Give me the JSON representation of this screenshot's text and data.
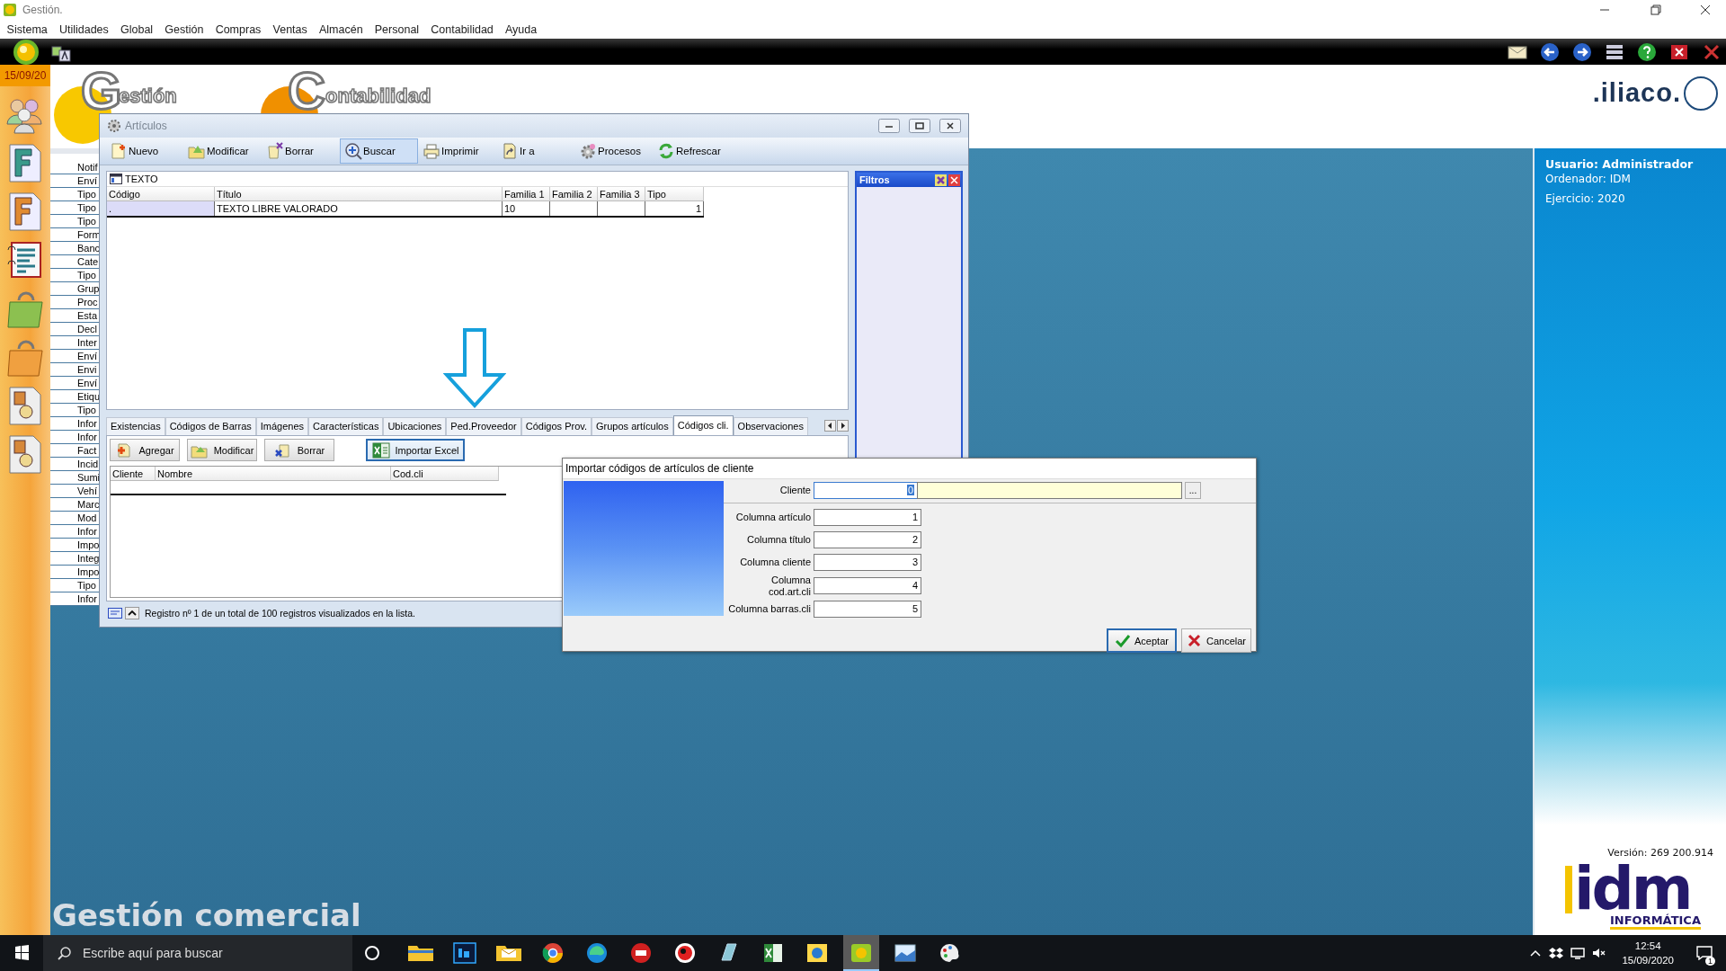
{
  "window": {
    "title": "Gestión."
  },
  "menu": [
    "Sistema",
    "Utilidades",
    "Global",
    "Gestión",
    "Compras",
    "Ventas",
    "Almacén",
    "Personal",
    "Contabilidad",
    "Ayuda"
  ],
  "date": "15/09/20",
  "banner": {
    "logos": [
      {
        "initial": "G",
        "rest": "estión"
      },
      {
        "initial": "C",
        "rest": "ontabilidad"
      }
    ],
    "brand": ".iliaco."
  },
  "sidebar_list": [
    "Notif",
    "Enví",
    "Tipo",
    "Tipo",
    "Tipo",
    "Form",
    "Banc",
    "Cate",
    "Tipo",
    "Grup",
    "Proc",
    "Esta",
    "Decl",
    "Inter",
    "Enví",
    "Envi",
    "Enví",
    "Etiqu",
    "Tipo",
    "Infor",
    "Infor",
    "Fact",
    "Incid",
    "Sumi",
    "Vehí",
    "Marc",
    "Mod",
    "Infor",
    "Impo",
    "Integ",
    "Impo",
    "Tipo",
    "Infor"
  ],
  "app_caption": "Gestión comercial",
  "user_panel": {
    "user": "Usuario: Administrador",
    "computer": "Ordenador: IDM",
    "year": "Ejercicio: 2020",
    "version": "Versión: 269 200.914",
    "logo": "idm",
    "logo_sub": "INFORMÁTICA"
  },
  "articulos": {
    "title": "Artículos",
    "toolbar": [
      {
        "label": "Nuevo",
        "selected": false
      },
      {
        "label": "Modificar",
        "selected": false
      },
      {
        "label": "Borrar",
        "selected": false
      },
      {
        "label": "Buscar",
        "selected": true
      },
      {
        "label": "Imprimir",
        "selected": false
      },
      {
        "label": "Ir a",
        "selected": false
      },
      {
        "label": "Procesos",
        "selected": false
      },
      {
        "label": "Refrescar",
        "selected": false
      }
    ],
    "grid": {
      "caption": "TEXTO",
      "columns": [
        "Código",
        "Título",
        "Familia 1",
        "Familia 2",
        "Familia 3",
        "Tipo"
      ],
      "rows": [
        {
          "cells": [
            ".",
            "TEXTO LIBRE VALORADO",
            "10",
            null,
            null,
            "1"
          ]
        }
      ]
    },
    "filters": {
      "title": "Filtros"
    },
    "tabs": [
      {
        "label": "Existencias",
        "selected": false
      },
      {
        "label": "Códigos de Barras",
        "selected": false
      },
      {
        "label": "Imágenes",
        "selected": false
      },
      {
        "label": "Características",
        "selected": false
      },
      {
        "label": "Ubicaciones",
        "selected": false
      },
      {
        "label": "Ped.Proveedor",
        "selected": false
      },
      {
        "label": "Códigos Prov.",
        "selected": false
      },
      {
        "label": "Grupos artículos",
        "selected": false
      },
      {
        "label": "Códigos cli.",
        "selected": true
      },
      {
        "label": "Observaciones",
        "selected": false
      }
    ],
    "detail_buttons": [
      {
        "label": "Agregar",
        "focused": false
      },
      {
        "label": "Modificar",
        "focused": false
      },
      {
        "label": "Borrar",
        "focused": false
      },
      {
        "label": "Importar Excel",
        "focused": true
      }
    ],
    "detail_grid": {
      "columns": [
        "Cliente",
        "Nombre",
        "Cod.cli"
      ]
    },
    "status": "Registro nº 1 de un total de 100 registros visualizados en la lista."
  },
  "dialog": {
    "title": "Importar códigos de artículos de cliente",
    "cliente": {
      "label": "Cliente",
      "value": "0",
      "browse": "..."
    },
    "fields": [
      {
        "label": "Columna artículo",
        "value": "1"
      },
      {
        "label": "Columna título",
        "value": "2"
      },
      {
        "label": "Columna cliente",
        "value": "3"
      },
      {
        "label": "Columna\ncod.art.cli",
        "value": "4"
      },
      {
        "label": "Columna barras.cli",
        "value": "5"
      }
    ],
    "buttons": [
      {
        "label": "Aceptar",
        "focused": true
      },
      {
        "label": "Cancelar",
        "focused": false
      }
    ]
  },
  "taskbar": {
    "search_placeholder": "Escribe aquí para buscar",
    "apps": [
      {
        "selected": false
      },
      {
        "selected": false
      },
      {
        "selected": false
      },
      {
        "selected": false
      },
      {
        "selected": false
      },
      {
        "selected": false
      },
      {
        "selected": false
      },
      {
        "selected": false
      },
      {
        "selected": false
      },
      {
        "selected": false
      },
      {
        "selected": true
      },
      {
        "selected": false
      },
      {
        "selected": false
      }
    ],
    "time": "12:54",
    "date": "15/09/2020",
    "notifications": "1"
  }
}
